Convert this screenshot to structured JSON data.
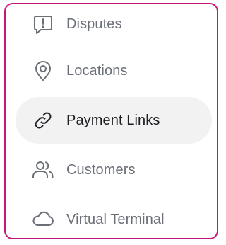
{
  "menu": {
    "items": [
      {
        "label": "Disputes",
        "icon": "dispute-alert-icon",
        "active": false
      },
      {
        "label": "Locations",
        "icon": "map-pin-icon",
        "active": false
      },
      {
        "label": "Payment Links",
        "icon": "link-icon",
        "active": true
      },
      {
        "label": "Customers",
        "icon": "users-icon",
        "active": false
      },
      {
        "label": "Virtual Terminal",
        "icon": "cloud-icon",
        "active": false
      }
    ]
  },
  "colors": {
    "border_accent": "#c2187a",
    "active_background": "#f2f2f3",
    "text_inactive": "#6b6f78",
    "text_active": "#1e1f23",
    "icon_inactive": "#6b6f78",
    "icon_active": "#1e1f23"
  }
}
